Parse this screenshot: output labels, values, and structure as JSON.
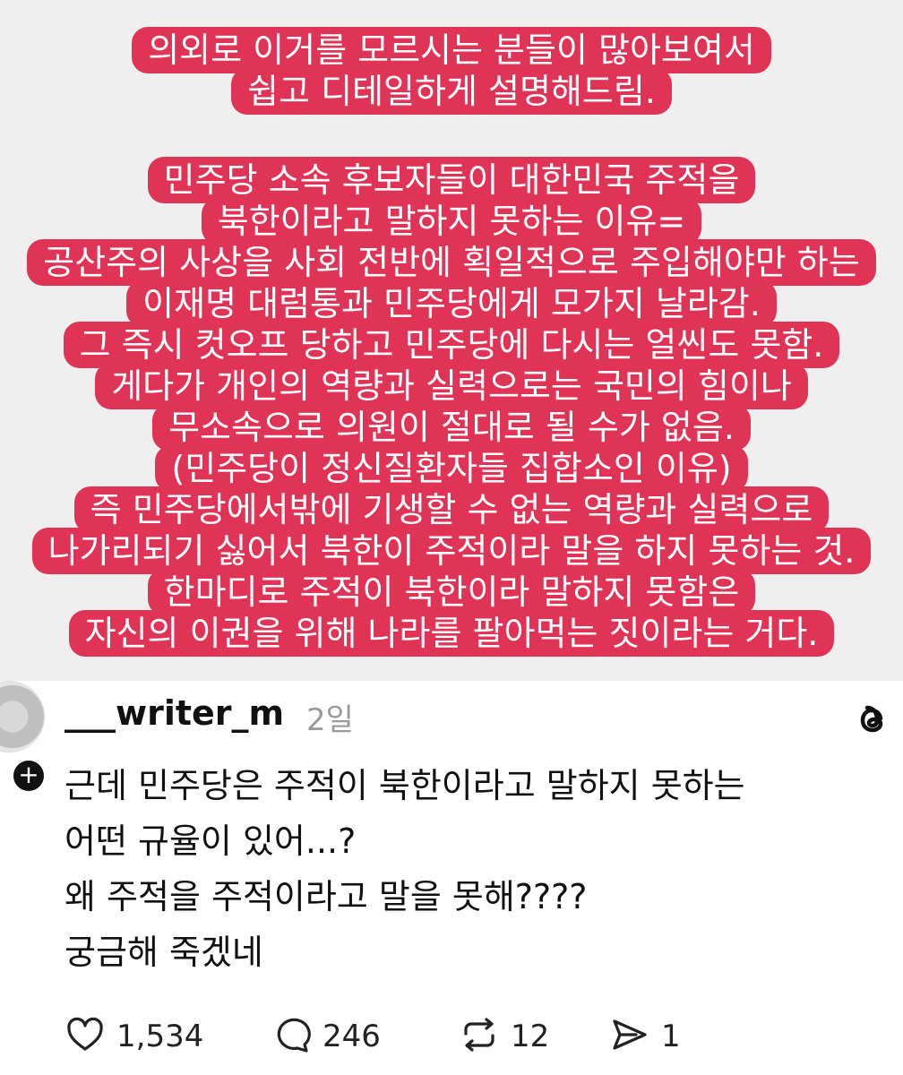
{
  "story": {
    "block1": [
      "의외로 이거를 모르시는 분들이 많아보여서",
      "쉽고 디테일하게 설명해드림."
    ],
    "block2": [
      "민주당 소속 후보자들이 대한민국 주적을",
      "북한이라고 말하지 못하는 이유=",
      "공산주의 사상을 사회 전반에 획일적으로 주입해야만 하는",
      "이재명 대럼통과 민주당에게 모가지 날라감.",
      "그 즉시 컷오프 당하고 민주당에 다시는 얼씬도 못함.",
      "게다가 개인의 역량과 실력으로는 국민의 힘이나",
      "무소속으로 의원이 절대로 될 수가 없음.",
      "(민주당이 정신질환자들 집합소인 이유)",
      "즉 민주당에서밖에 기생할 수 없는 역량과 실력으로",
      "나가리되기 싫어서 북한이 주적이라 말을 하지 못하는 것.",
      "한마디로 주적이 북한이라 말하지 못함은",
      "자신의 이권을 위해 나라를 팔아먹는 짓이라는 거다."
    ],
    "highlight_color": "#e03457"
  },
  "post": {
    "username": "___writer_m",
    "time": "2일",
    "comment_lines": [
      "근데 민주당은 주적이 북한이라고 말하지 못하는",
      "어떤 규율이 있어...?",
      "왜 주적을 주적이라고 말을 못해????",
      "궁금해 죽겠네"
    ],
    "likes": "1,534",
    "replies": "246",
    "reposts": "12",
    "shares": "1"
  }
}
